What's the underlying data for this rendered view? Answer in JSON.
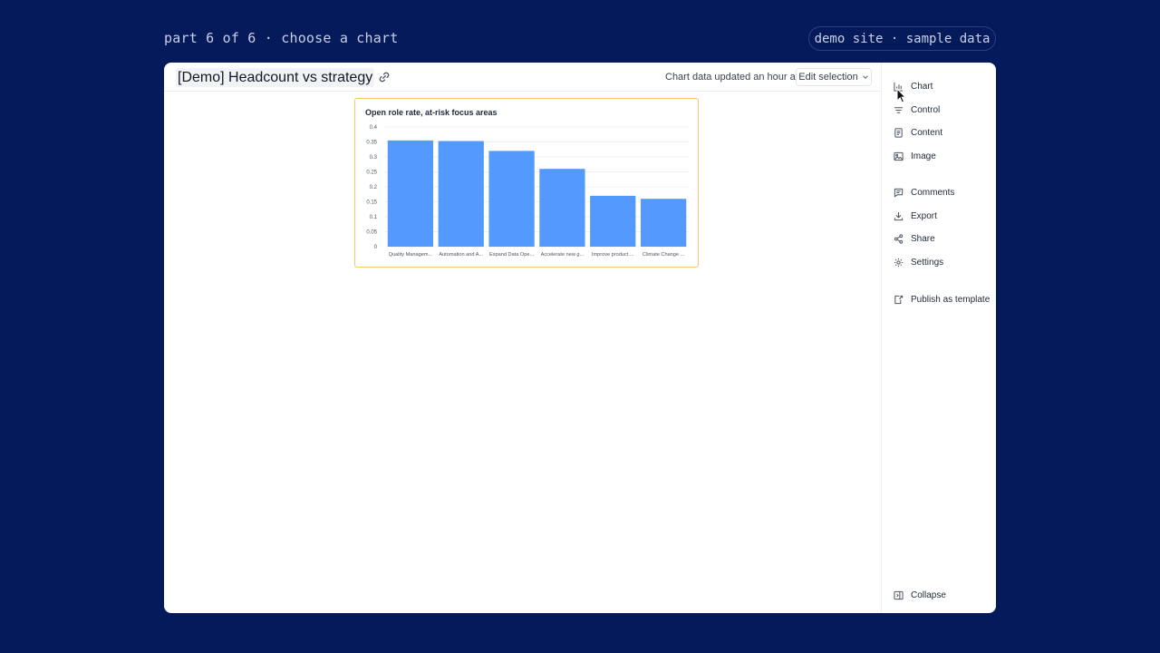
{
  "caption": "part 6 of 6 · choose a chart",
  "badge": "demo site · sample data",
  "header": {
    "title": "[Demo] Headcount vs strategy",
    "updated": "Chart data updated an hour ago",
    "edit_label": "Edit selection"
  },
  "chart_data": {
    "type": "bar",
    "title": "Open role rate, at-risk focus areas",
    "categories": [
      "Quality Managem...",
      "Automation and A...",
      "Expand Data Ope...",
      "Accelerate new g...",
      "Improve product ...",
      "Climate Change ..."
    ],
    "values": [
      0.355,
      0.353,
      0.32,
      0.26,
      0.17,
      0.16
    ],
    "ylim": [
      0,
      0.4
    ],
    "yticks": [
      "0",
      "0.05",
      "0.1",
      "0.15",
      "0.2",
      "0.25",
      "0.3",
      "0.35",
      "0.4"
    ],
    "bar_color": "#5499fd",
    "grid": true
  },
  "sidebar": {
    "items": [
      {
        "label": "Chart",
        "icon": "bar-chart-icon"
      },
      {
        "label": "Control",
        "icon": "filter-icon"
      },
      {
        "label": "Content",
        "icon": "document-icon"
      },
      {
        "label": "Image",
        "icon": "image-icon"
      },
      {
        "label": "Comments",
        "icon": "comment-icon"
      },
      {
        "label": "Export",
        "icon": "download-icon"
      },
      {
        "label": "Share",
        "icon": "share-icon"
      },
      {
        "label": "Settings",
        "icon": "gear-icon"
      },
      {
        "label": "Publish as template",
        "icon": "template-icon"
      }
    ],
    "collapse": "Collapse"
  },
  "colors": {
    "background": "#051a5a",
    "accent_border": "#f2c76e"
  }
}
